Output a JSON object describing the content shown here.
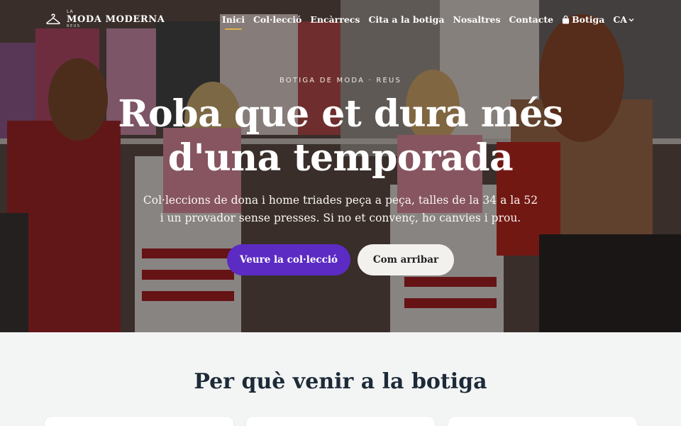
{
  "brand": {
    "small": "LA",
    "name": "MODA MODERNA",
    "city": "REUS",
    "logo_icon": "hanger-icon"
  },
  "nav": {
    "items": [
      {
        "label": "Inici",
        "active": true
      },
      {
        "label": "Col·lecció"
      },
      {
        "label": "Encàrrecs"
      },
      {
        "label": "Cita a la botiga"
      },
      {
        "label": "Nosaltres"
      },
      {
        "label": "Contacte"
      }
    ],
    "shop_label": "Botiga",
    "shop_icon": "shopping-bag-icon",
    "language": "CA",
    "language_icon": "chevron-down-icon",
    "active_underline_color": "#e0b24a"
  },
  "hero": {
    "eyebrow": "BOTIGA DE MODA · REUS",
    "title": "Roba que et dura més d'una temporada",
    "subtitle": "Col·leccions de dona i home triades peça a peça, talles de la 34 a la 52 i un provador sense presses. Si no et convenç, ho canvies i prou.",
    "primary_button": "Veure la col·lecció",
    "secondary_button": "Com arribar",
    "primary_color": "#5b2bc4"
  },
  "why": {
    "title": "Per què venir a la botiga"
  }
}
